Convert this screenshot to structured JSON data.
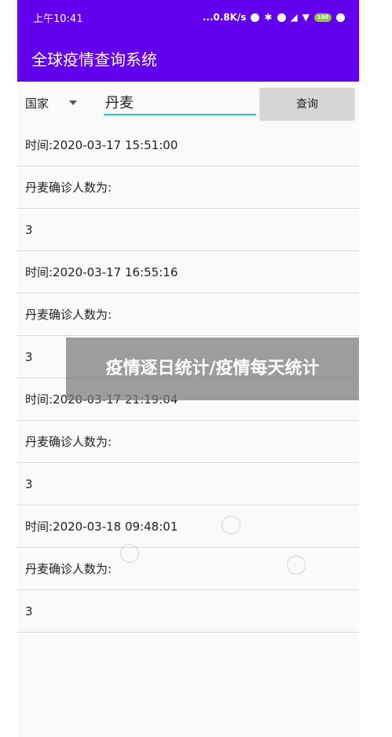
{
  "status_bar": {
    "time": "上午10:41",
    "network_speed": "...0.8K/s",
    "battery": "100"
  },
  "app": {
    "title": "全球疫情查询系统"
  },
  "query": {
    "spinner_label": "国家",
    "country_value": "丹麦",
    "button_label": "查询"
  },
  "results": [
    "时间:2020-03-17 15:51:00",
    "丹麦确诊人数为:",
    "3",
    "时间:2020-03-17 16:55:16",
    "丹麦确诊人数为:",
    "3",
    "时间:2020-03-17 21:19:04",
    "丹麦确诊人数为:",
    "3",
    "时间:2020-03-18 09:48:01",
    "丹麦确诊人数为:",
    "3"
  ],
  "overlay": {
    "text": "疫情逐日统计/疫情每天统计"
  },
  "colors": {
    "primary": "#6200ee",
    "accent": "#26c6c6",
    "button": "#d6d6d6"
  }
}
